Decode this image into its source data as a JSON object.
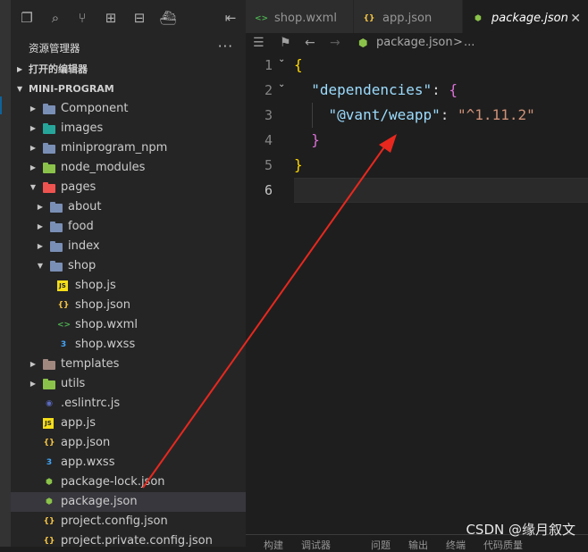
{
  "explorer": {
    "title": "资源管理器",
    "more": "···",
    "open_editors": "打开的编辑器",
    "project": "MINI-PROGRAM",
    "items": [
      {
        "label": "Component",
        "depth": 0,
        "arrow": "▶",
        "icon": "folder-icon",
        "color": "#7a8fb5"
      },
      {
        "label": "images",
        "depth": 0,
        "arrow": "▶",
        "icon": "images-folder-icon",
        "color": "#26a69a"
      },
      {
        "label": "miniprogram_npm",
        "depth": 0,
        "arrow": "▶",
        "icon": "folder-icon",
        "color": "#7a8fb5"
      },
      {
        "label": "node_modules",
        "depth": 0,
        "arrow": "▶",
        "icon": "node-folder-icon",
        "color": "#8bc34a"
      },
      {
        "label": "pages",
        "depth": 0,
        "arrow": "▼",
        "icon": "pages-folder-icon",
        "color": "#ef5350"
      },
      {
        "label": "about",
        "depth": 1,
        "arrow": "▶",
        "icon": "folder-icon",
        "color": "#7a8fb5"
      },
      {
        "label": "food",
        "depth": 1,
        "arrow": "▶",
        "icon": "folder-icon",
        "color": "#7a8fb5"
      },
      {
        "label": "index",
        "depth": 1,
        "arrow": "▶",
        "icon": "folder-icon",
        "color": "#7a8fb5"
      },
      {
        "label": "shop",
        "depth": 1,
        "arrow": "▼",
        "icon": "open-folder-icon",
        "color": "#7a8fb5"
      },
      {
        "label": "shop.js",
        "depth": 2,
        "arrow": "",
        "icon": "js-file-icon",
        "color": "#f5de19",
        "glyph": "JS"
      },
      {
        "label": "shop.json",
        "depth": 2,
        "arrow": "",
        "icon": "json-file-icon",
        "color": "#f5c542",
        "glyph": "{}"
      },
      {
        "label": "shop.wxml",
        "depth": 2,
        "arrow": "",
        "icon": "wxml-file-icon",
        "color": "#4caf50",
        "glyph": "<>"
      },
      {
        "label": "shop.wxss",
        "depth": 2,
        "arrow": "",
        "icon": "css-file-icon",
        "color": "#42a5f5",
        "glyph": "3"
      },
      {
        "label": "templates",
        "depth": 0,
        "arrow": "▶",
        "icon": "templates-folder-icon",
        "color": "#a1887f"
      },
      {
        "label": "utils",
        "depth": 0,
        "arrow": "▶",
        "icon": "utils-folder-icon",
        "color": "#8bc34a"
      },
      {
        "label": ".eslintrc.js",
        "depth": 0,
        "arrow": "",
        "icon": "eslint-file-icon",
        "color": "#5c6bc0",
        "glyph": "◉"
      },
      {
        "label": "app.js",
        "depth": 0,
        "arrow": "",
        "icon": "js-file-icon",
        "color": "#f5de19",
        "glyph": "JS"
      },
      {
        "label": "app.json",
        "depth": 0,
        "arrow": "",
        "icon": "json-file-icon",
        "color": "#f5c542",
        "glyph": "{}"
      },
      {
        "label": "app.wxss",
        "depth": 0,
        "arrow": "",
        "icon": "css-file-icon",
        "color": "#42a5f5",
        "glyph": "3"
      },
      {
        "label": "package-lock.json",
        "depth": 0,
        "arrow": "",
        "icon": "node-package-icon",
        "color": "#8bc34a",
        "glyph": "⬢"
      },
      {
        "label": "package.json",
        "depth": 0,
        "arrow": "",
        "icon": "node-package-icon",
        "color": "#8bc34a",
        "glyph": "⬢",
        "selected": true
      },
      {
        "label": "project.config.json",
        "depth": 0,
        "arrow": "",
        "icon": "json-file-icon",
        "color": "#f5c542",
        "glyph": "{}"
      },
      {
        "label": "project.private.config.json",
        "depth": 0,
        "arrow": "",
        "icon": "json-file-icon",
        "color": "#f5c542",
        "glyph": "{}"
      }
    ]
  },
  "tabs": [
    {
      "label": "shop.wxml",
      "icon": "wxml-file-icon",
      "glyph": "<>",
      "color": "#4caf50",
      "active": false
    },
    {
      "label": "app.json",
      "icon": "json-file-icon",
      "glyph": "{}",
      "color": "#f5c542",
      "active": false
    },
    {
      "label": "package.json",
      "icon": "node-package-icon",
      "glyph": "⬢",
      "color": "#8bc34a",
      "active": true,
      "close": "✕"
    }
  ],
  "breadcrumb": {
    "file": "package.json",
    "sep": ">",
    "rest": "..."
  },
  "editor": {
    "line_numbers": [
      "1",
      "2",
      "3",
      "4",
      "5",
      "6"
    ],
    "current_line": "6",
    "code": {
      "l1_brace": "{",
      "l2_key": "\"dependencies\"",
      "l2_colon": ": ",
      "l2_brace": "{",
      "l3_key": "\"@vant/weapp\"",
      "l3_colon": ": ",
      "l3_value": "\"^1.11.2\"",
      "l4_brace": "}",
      "l5_brace": "}"
    }
  },
  "bottom_panel": [
    "构建",
    "调试器",
    "问题",
    "输出",
    "终端",
    "代码质量"
  ],
  "watermark": "CSDN @缘月叙文",
  "annotation": {
    "color": "#e8281e"
  }
}
